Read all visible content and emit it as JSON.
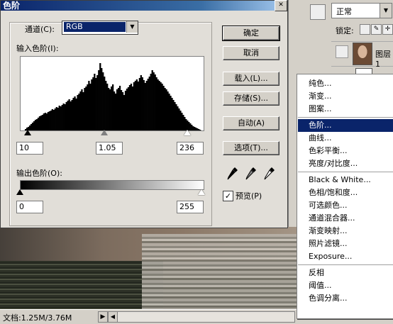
{
  "dialog": {
    "title": "色阶",
    "channel_label": "通道(C):",
    "channel_value": "RGB",
    "input_levels_label": "输入色阶(I):",
    "input_black": "10",
    "input_gamma": "1.05",
    "input_white": "236",
    "output_levels_label": "输出色阶(O):",
    "output_black": "0",
    "output_white": "255",
    "buttons": {
      "ok": "确定",
      "cancel": "取消",
      "load": "载入(L)...",
      "save": "存储(S)...",
      "auto": "自动(A)",
      "options": "选项(T)..."
    },
    "preview_label": "预览(P)",
    "preview_checked": true
  },
  "histogram": {
    "bins": [
      0,
      0,
      0,
      2,
      4,
      5,
      7,
      9,
      11,
      13,
      15,
      16,
      18,
      20,
      21,
      22,
      24,
      25,
      24,
      26,
      27,
      28,
      30,
      29,
      31,
      33,
      32,
      35,
      34,
      36,
      38,
      37,
      40,
      42,
      44,
      41,
      43,
      46,
      48,
      45,
      50,
      52,
      55,
      58,
      54,
      60,
      62,
      65,
      70,
      66,
      72,
      75,
      80,
      74,
      78,
      85,
      95,
      88,
      82,
      76,
      70,
      66,
      60,
      58,
      62,
      65,
      55,
      52,
      58,
      60,
      63,
      57,
      54,
      50,
      56,
      59,
      61,
      64,
      66,
      62,
      68,
      70,
      72,
      69,
      74,
      78,
      75,
      71,
      67,
      70,
      73,
      76,
      80,
      85,
      82,
      79,
      75,
      72,
      70,
      68,
      66,
      63,
      60,
      58,
      55,
      52,
      49,
      46,
      43,
      40,
      37,
      34,
      31,
      28,
      25,
      22,
      19,
      16,
      14,
      12,
      10,
      8,
      6,
      5,
      4,
      3,
      2,
      1,
      0,
      0
    ]
  },
  "statusbar": {
    "doc_info": "文档:1.25M/3.76M"
  },
  "palette": {
    "blend_mode": "正常",
    "lock_label": "锁定:",
    "layer_name": "图层 1"
  },
  "menu": {
    "items": [
      {
        "label": "纯色...",
        "selected": false
      },
      {
        "label": "渐变...",
        "selected": false
      },
      {
        "label": "图案...",
        "selected": false
      },
      {
        "label": "色阶...",
        "selected": true
      },
      {
        "label": "曲线...",
        "selected": false
      },
      {
        "label": "色彩平衡...",
        "selected": false
      },
      {
        "label": "亮度/对比度...",
        "selected": false
      },
      {
        "label": "Black & White...",
        "selected": false
      },
      {
        "label": "色相/饱和度...",
        "selected": false
      },
      {
        "label": "可选颜色...",
        "selected": false
      },
      {
        "label": "通道混合器...",
        "selected": false
      },
      {
        "label": "渐变映射...",
        "selected": false
      },
      {
        "label": "照片滤镜...",
        "selected": false
      },
      {
        "label": "Exposure...",
        "selected": false
      },
      {
        "label": "反相",
        "selected": false
      },
      {
        "label": "阈值...",
        "selected": false
      },
      {
        "label": "色调分离...",
        "selected": false
      }
    ]
  }
}
